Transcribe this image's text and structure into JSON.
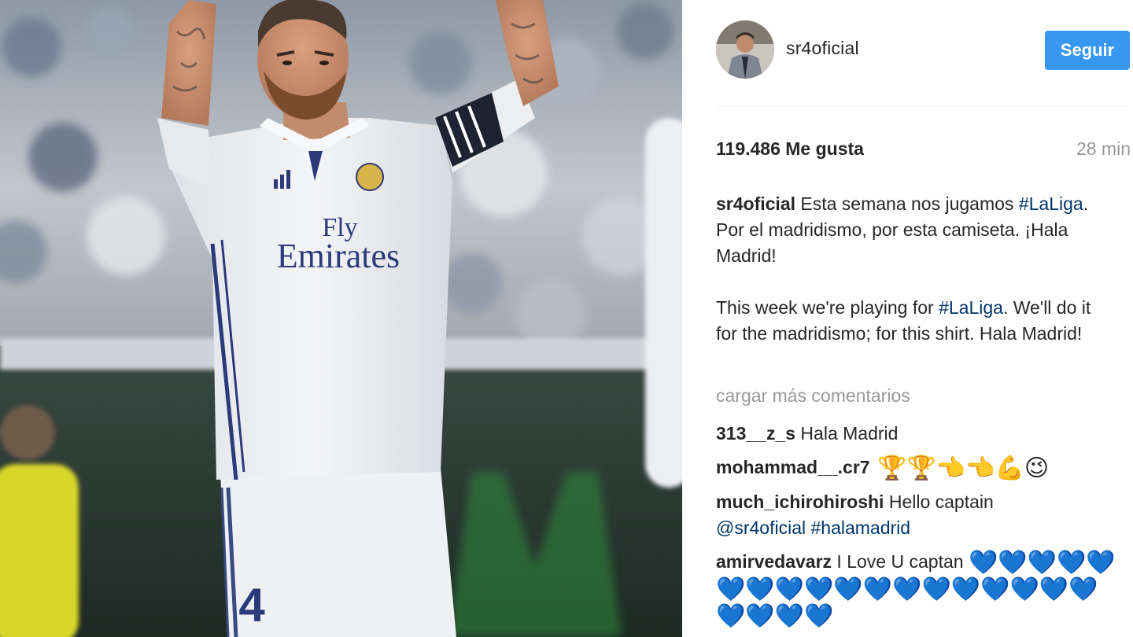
{
  "post": {
    "username": "sr4oficial",
    "follow_label": "Seguir",
    "likes": "119.486 Me gusta",
    "time_ago": "28 min",
    "caption": {
      "author": "sr4oficial",
      "es_line1_text": " Esta semana nos jugamos",
      "es_hashtag": "#LaLiga",
      "es_line2_text": ". Por el madridismo, por esta camiseta. ¡Hala Madrid!",
      "en_text_before": "This week we're playing for ",
      "en_hashtag": "#LaLiga",
      "en_text_after": ". We'll do it for the madridismo; for this shirt. Hala Madrid!"
    },
    "load_more_comments": "cargar más comentarios"
  },
  "comments": [
    {
      "user": "313__z_s",
      "text": " Hala Madrid"
    },
    {
      "user": "mohammad__.cr7",
      "text": " 🏆🏆👈👈💪😉"
    },
    {
      "user": "much_ichirohiroshi",
      "text": " Hello captain ",
      "mention": "@sr4oficial",
      "hashtag": "#halamadrid"
    },
    {
      "user": "amirvedavarz",
      "text": " I Love U captan ",
      "hearts": "💙💙💙💙💙💙💙💙💙💙💙💙💙💙💙💙💙💙💙💙💙💙"
    }
  ],
  "photo": {
    "jersey_sponsor_line1": "Fly",
    "jersey_sponsor_line2": "Emirates",
    "shorts_number": "4"
  },
  "colors": {
    "accent": "#3897f0",
    "hashtag": "#003569",
    "muted": "#999999",
    "text": "#262626"
  }
}
